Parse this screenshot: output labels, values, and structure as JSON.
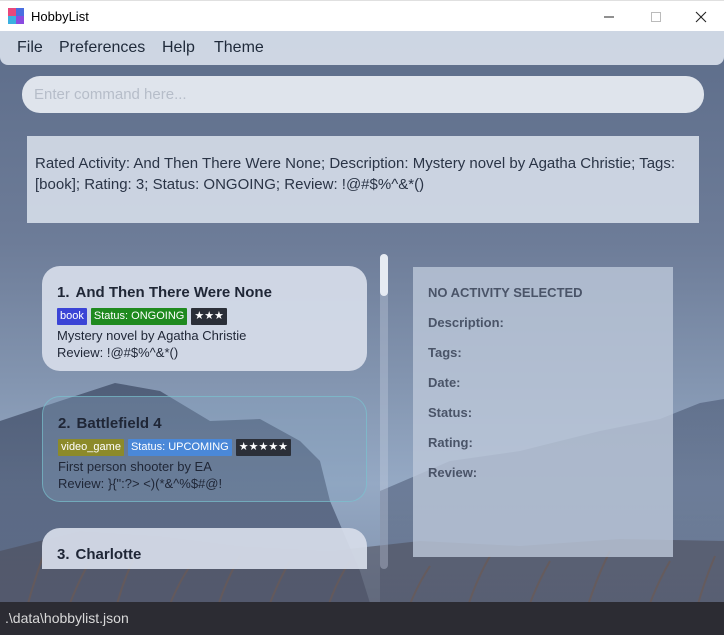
{
  "window": {
    "title": "HobbyList",
    "icons": {
      "app": "hobbylist-app-icon",
      "minimize": "minimize-icon",
      "maximize": "maximize-icon",
      "close": "close-icon"
    }
  },
  "menu": {
    "items": [
      "File",
      "Preferences",
      "Help",
      "Theme"
    ]
  },
  "command": {
    "placeholder": "Enter command here...",
    "value": ""
  },
  "result": {
    "text": "Rated Activity: And Then There Were None; Description: Mystery novel by Agatha Christie; Tags: [book]; Rating: 3; Status: ONGOING; Review: !@#$%^&*()"
  },
  "activities": [
    {
      "index": "1.",
      "name": "And Then There Were None",
      "tags": [
        {
          "text": "book",
          "color": "#3b44d6"
        },
        {
          "text": "Status: ONGOING",
          "color": "#1f8a1f"
        },
        {
          "text": "★★★",
          "color": "#2b2f38"
        }
      ],
      "description": "Mystery novel by Agatha Christie",
      "review": "Review: !@#$%^&*()"
    },
    {
      "index": "2.",
      "name": "Battlefield 4",
      "tags": [
        {
          "text": "video_game",
          "color": "#8c8a2a"
        },
        {
          "text": "Status: UPCOMING",
          "color": "#4a88d8"
        },
        {
          "text": "★★★★★",
          "color": "#2b2f38"
        }
      ],
      "description": "First person shooter by EA",
      "review": "Review: }{\":?> <)(*&^%$#@!"
    },
    {
      "index": "3.",
      "name": "Charlotte",
      "tags": [
        {
          "text": "",
          "color": "#8a8a8a"
        },
        {
          "text": "",
          "color": "#2fd8c8"
        },
        {
          "text": "",
          "color": "#e02a2a"
        }
      ],
      "description": "",
      "review": ""
    }
  ],
  "detail": {
    "heading": "NO ACTIVITY SELECTED",
    "fields": [
      "Description:",
      "Tags:",
      "Date:",
      "Status:",
      "Rating:",
      "Review:"
    ]
  },
  "status_bar": {
    "path": ".\\data\\hobbylist.json"
  },
  "colors": {
    "menubar": "#d6deea",
    "statusbar": "#2c2c33",
    "accent_teal": "#2fd8c8"
  }
}
